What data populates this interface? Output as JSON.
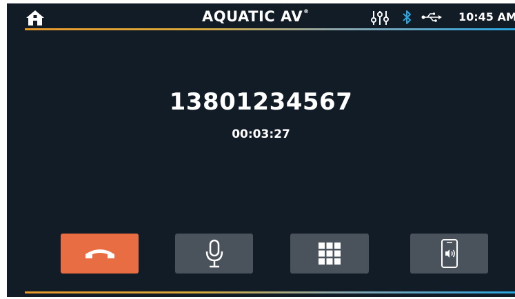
{
  "header": {
    "brand": "AQUATIC AV",
    "brand_mark": "®",
    "time": "10:45 AM",
    "icons": [
      "home-icon",
      "equalizer-icon",
      "bluetooth-icon",
      "usb-icon"
    ]
  },
  "call": {
    "number": "13801234567",
    "duration": "00:03:27"
  },
  "controls": [
    {
      "name": "end-call",
      "icon": "phone-hangup-icon",
      "color": "#e96d43"
    },
    {
      "name": "microphone",
      "icon": "microphone-icon",
      "color": "#4a525b"
    },
    {
      "name": "keypad",
      "icon": "keypad-icon",
      "color": "#4a525b"
    },
    {
      "name": "audio-transfer",
      "icon": "phone-speaker-icon",
      "color": "#4a525b"
    }
  ],
  "colors": {
    "background": "#121c26",
    "accent_orange": "#e89a2a",
    "accent_blue": "#2aa6e0",
    "bluetooth": "#2aa6e0"
  }
}
